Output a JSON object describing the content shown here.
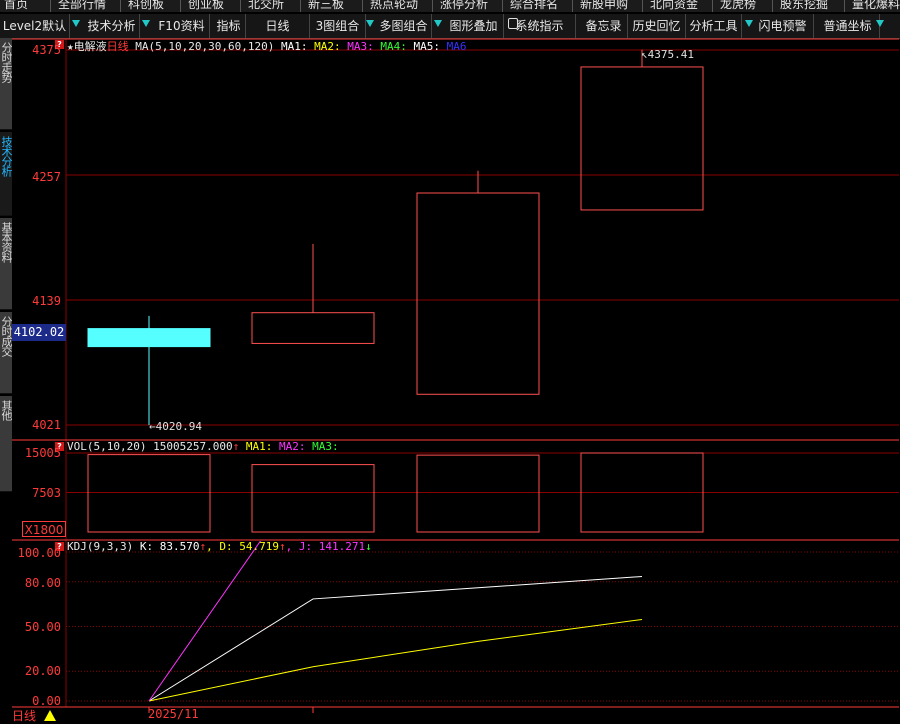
{
  "top_nav": [
    "首页",
    "全部行情",
    "科创板",
    "创业板",
    "北交所",
    "新三板",
    "热点轮动",
    "涨停分析",
    "综合排名",
    "新股申购",
    "北向资金",
    "龙虎榜",
    "股东挖掘",
    "量化爆料"
  ],
  "toolbar": {
    "items": [
      "Level2默认",
      "技术分析",
      "F10资料",
      "指标",
      "日线",
      "3图组合",
      "多图组合",
      "图形叠加",
      "系统指示",
      "备忘录",
      "历史回忆",
      "分析工具",
      "闪电预警",
      "普通坐标"
    ],
    "accent_color": "#22c8c8"
  },
  "left_tabs": [
    "分时走势",
    "技术分析",
    "基本资料",
    "分时成交",
    "其他"
  ],
  "price_panel": {
    "stock_name": "★电解液",
    "period": "日线",
    "ma_label": "MA(5,10,20,30,60,120)",
    "ma_items": [
      {
        "name": "MA1:",
        "color": "#ffffff"
      },
      {
        "name": "MA2:",
        "color": "#ffff00"
      },
      {
        "name": "MA3:",
        "color": "#ff33ff"
      },
      {
        "name": "MA4:",
        "color": "#33ff33"
      },
      {
        "name": "MA5:",
        "color": "#ffffff"
      },
      {
        "name": "MA6",
        "color": "#3333ff"
      }
    ],
    "y_ticks": [
      "4375",
      "4257",
      "4139",
      "4021"
    ],
    "current_price": "4102.02",
    "high_mark": "4375.41",
    "low_mark": "4020.94"
  },
  "vol_panel": {
    "label": "VOL(5,10,20)",
    "value": "15005257.000",
    "up_arrow": "↑",
    "ma_items": [
      {
        "name": "MA1:",
        "color": "#ffff00"
      },
      {
        "name": "MA2:",
        "color": "#ff33ff"
      },
      {
        "name": "MA3:",
        "color": "#33ff33"
      }
    ],
    "y_ticks": [
      "15005",
      "7503"
    ],
    "unit": "X1800"
  },
  "kdj_panel": {
    "label": "KDJ(9,3,3)",
    "k_label": "K:",
    "k_value": "83.570",
    "k_arrow": "↑",
    "d_label": "D:",
    "d_value": "54.719",
    "d_arrow": "↑",
    "j_label": "J:",
    "j_value": "141.271",
    "j_arrow": "↓",
    "y_ticks": [
      "100.00",
      "80.00",
      "50.00",
      "20.00",
      "0.00"
    ]
  },
  "bottom_bar": {
    "period_label": "日线",
    "date_label": "2025/11"
  },
  "colors": {
    "grid": "#8a0000",
    "axis_text": "#ff3a3a",
    "up": "#ff5050",
    "down": "#55ffff"
  },
  "chart_data": {
    "type": "candlestick",
    "price": {
      "ylim": [
        4021,
        4375
      ],
      "candles": [
        {
          "open": 4112,
          "close": 4095,
          "high": 4124,
          "low": 4020.94,
          "color": "down"
        },
        {
          "open": 4098,
          "close": 4127,
          "high": 4192,
          "low": 4098,
          "color": "up"
        },
        {
          "open": 4050,
          "close": 4240,
          "high": 4261,
          "low": 4050,
          "color": "up"
        },
        {
          "open": 4224,
          "close": 4359,
          "high": 4375.41,
          "low": 4224,
          "color": "up"
        }
      ]
    },
    "volume": {
      "ylim": [
        0,
        15005
      ],
      "values": [
        14700,
        12800,
        14600,
        15005
      ],
      "colors": [
        "up",
        "up",
        "up",
        "up"
      ]
    },
    "kdj": {
      "ylim": [
        0,
        100
      ],
      "series": [
        {
          "name": "K",
          "values": [
            0,
            68.5,
            76,
            83.57
          ],
          "color": "#ffffff"
        },
        {
          "name": "D",
          "values": [
            0,
            23,
            40,
            54.719
          ],
          "color": "#ffff00"
        },
        {
          "name": "J",
          "values": [
            0,
            158,
            176,
            141.271
          ],
          "color": "#ff33ff"
        }
      ]
    }
  }
}
